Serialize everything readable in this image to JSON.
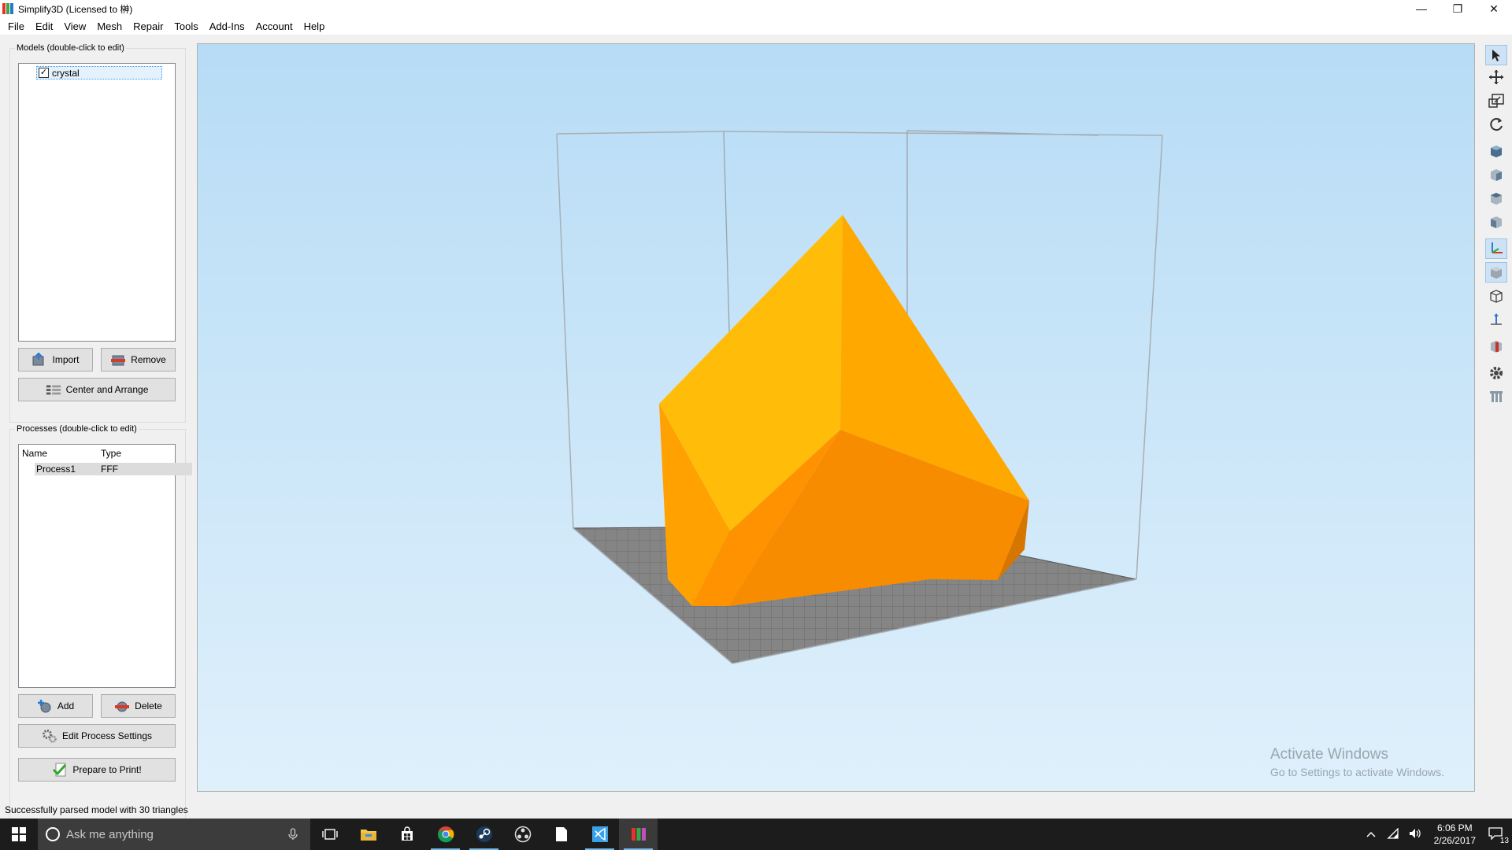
{
  "window": {
    "title": "Simplify3D (Licensed to 榊)",
    "controls": {
      "minimize": "—",
      "restore": "❐",
      "close": "✕"
    }
  },
  "menu": [
    "File",
    "Edit",
    "View",
    "Mesh",
    "Repair",
    "Tools",
    "Add-Ins",
    "Account",
    "Help"
  ],
  "models": {
    "group_title": "Models (double-click to edit)",
    "items": [
      {
        "name": "crystal",
        "checked": true
      }
    ],
    "import_label": "Import",
    "remove_label": "Remove",
    "center_label": "Center and Arrange"
  },
  "processes": {
    "group_title": "Processes (double-click to edit)",
    "columns": [
      "Name",
      "Type"
    ],
    "rows": [
      {
        "name": "Process1",
        "type": "FFF"
      }
    ],
    "add_label": "Add",
    "delete_label": "Delete",
    "edit_label": "Edit Process Settings",
    "prepare_label": "Prepare to Print!"
  },
  "viewport": {
    "watermark_title": "Activate Windows",
    "watermark_sub": "Go to Settings to activate Windows.",
    "model_color": "#ffad00",
    "bed_color": "#7a7a7a"
  },
  "toolbar_icons": [
    "select-arrow-icon",
    "move-icon",
    "scale-icon",
    "rotate-icon",
    "view-default-icon",
    "view-front-icon",
    "view-top-icon",
    "view-side-icon",
    "axes-icon",
    "solid-view-icon",
    "wireframe-view-icon",
    "z-axis-icon",
    "cross-section-icon",
    "settings-gear-icon",
    "supports-icon"
  ],
  "status": "Successfully parsed model with 30 triangles",
  "taskbar": {
    "search_placeholder": "Ask me anything",
    "time": "6:06 PM",
    "date": "2/26/2017",
    "notifications": "13"
  }
}
